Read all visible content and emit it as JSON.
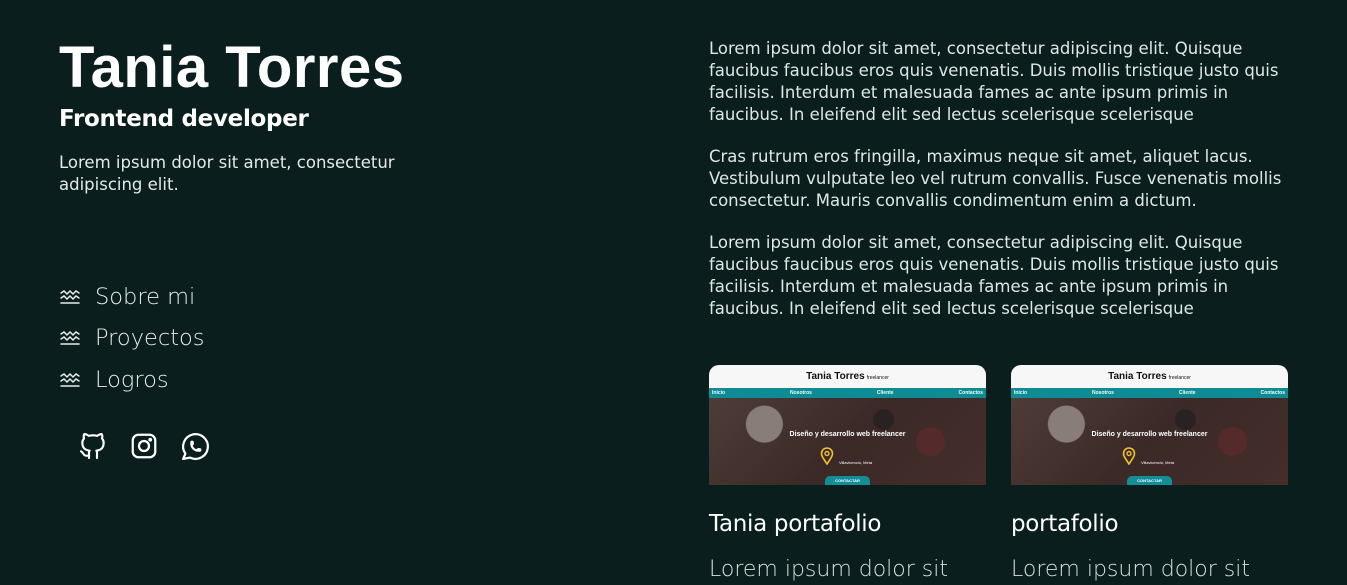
{
  "profile": {
    "name": "Tania Torres",
    "role": "Frontend developer",
    "intro": "Lorem ipsum dolor sit amet, consectetur adipiscing elit."
  },
  "nav": {
    "items": [
      {
        "label": "Sobre mi",
        "icon": "waves-icon"
      },
      {
        "label": "Proyectos",
        "icon": "waves-icon"
      },
      {
        "label": "Logros",
        "icon": "waves-icon"
      }
    ]
  },
  "socials": [
    {
      "icon": "github-icon"
    },
    {
      "icon": "instagram-icon"
    },
    {
      "icon": "whatsapp-icon"
    }
  ],
  "about": {
    "paragraphs": [
      "Lorem ipsum dolor sit amet, consectetur adipiscing elit. Quisque faucibus faucibus eros quis venenatis. Duis mollis tristique justo quis facilisis. Interdum et malesuada fames ac ante ipsum primis in faucibus. In eleifend elit sed lectus scelerisque scelerisque",
      "Cras rutrum eros fringilla, maximus neque sit amet, aliquet lacus. Vestibulum vulputate leo vel rutrum convallis. Fusce venenatis mollis consectetur. Mauris convallis condimentum enim a dictum.",
      "Lorem ipsum dolor sit amet, consectetur adipiscing elit. Quisque faucibus faucibus eros quis venenatis. Duis mollis tristique justo quis facilisis. Interdum et malesuada fames ac ante ipsum primis in faucibus. In eleifend elit sed lectus scelerisque scelerisque"
    ]
  },
  "projects": [
    {
      "title": "Tania portafolio",
      "text": "Lorem ipsum dolor sit",
      "thumb": {
        "brand": "Tania Torres",
        "brand_tag": "freelancer",
        "nav": [
          "Inicio",
          "Nosotros",
          "Cliente",
          "Contactos"
        ],
        "hero_title": "Diseño y desarrollo web freelancer",
        "location": "Villavicencio, Meta",
        "button": "CONTACTAR"
      }
    },
    {
      "title": "portafolio",
      "text": "Lorem ipsum dolor sit",
      "thumb": {
        "brand": "Tania Torres",
        "brand_tag": "freelancer",
        "nav": [
          "Inicio",
          "Nosotros",
          "Cliente",
          "Contactos"
        ],
        "hero_title": "Diseño y desarrollo web freelancer",
        "location": "Villavicencio, Meta",
        "button": "CONTACTAR"
      }
    }
  ],
  "colors": {
    "background": "#0a1f1d",
    "text": "#ffffff",
    "thumb_accent": "#0f8b93",
    "pin": "#f2c12e"
  }
}
